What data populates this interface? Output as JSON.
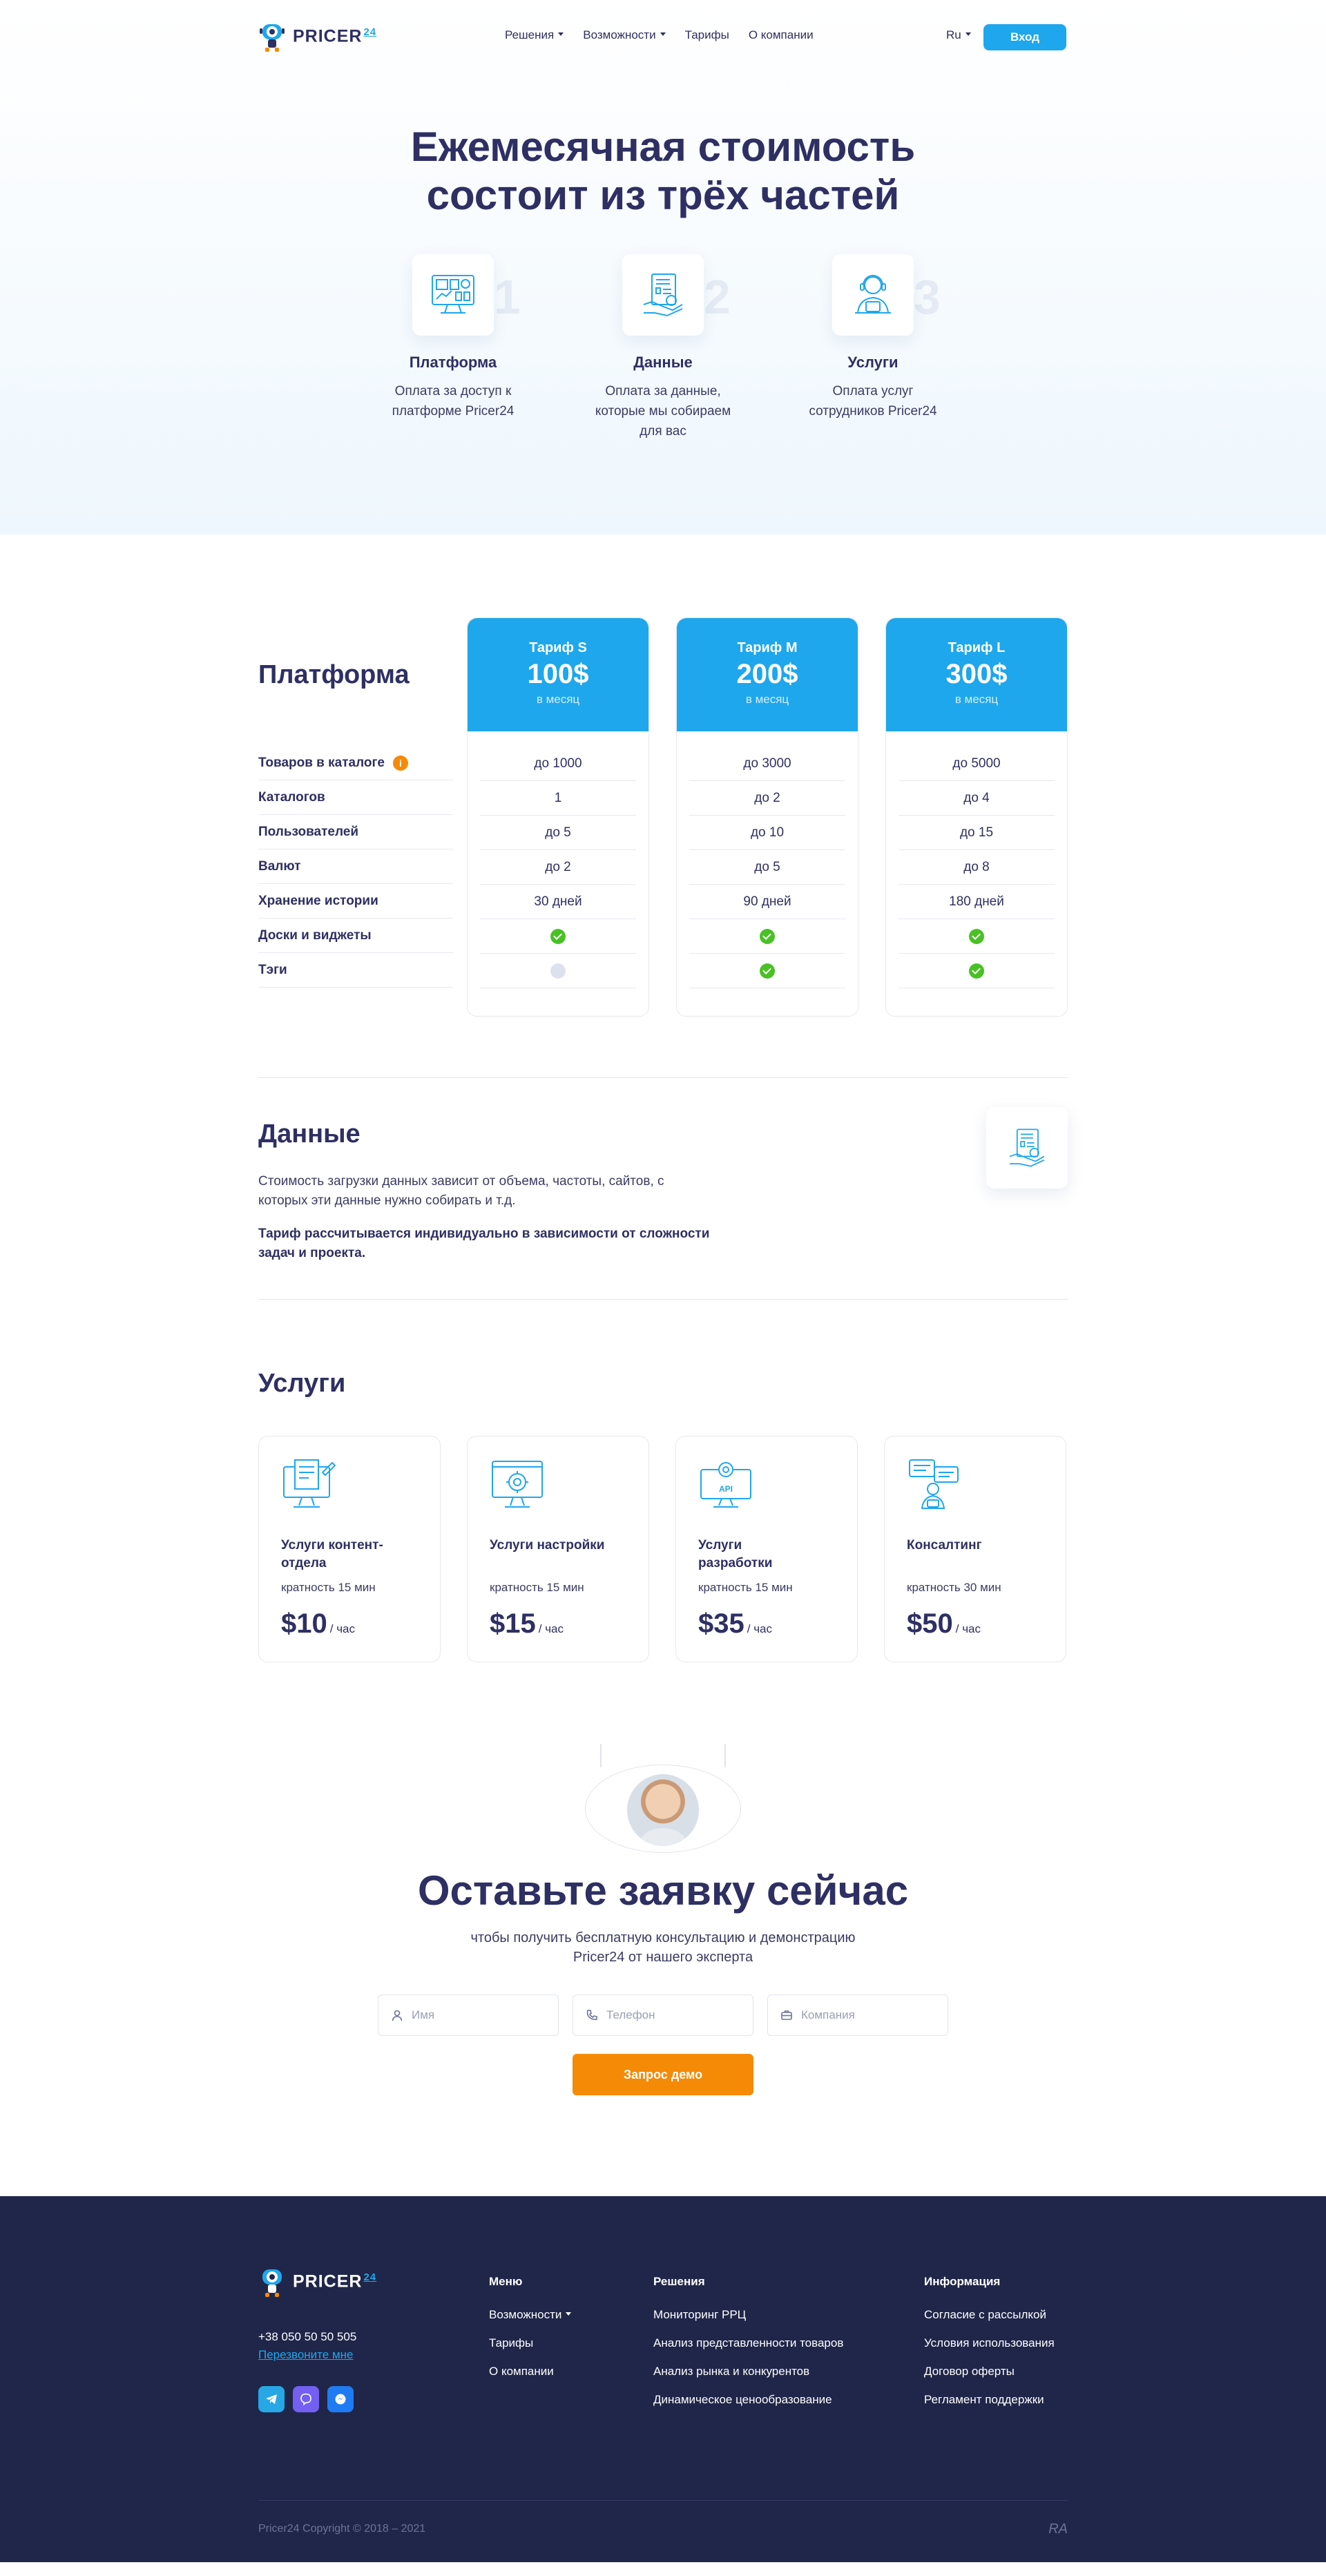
{
  "header": {
    "logo_text": "PRICER",
    "logo_num": "24",
    "nav": [
      "Решения",
      "Возможности",
      "Тарифы",
      "О компании"
    ],
    "lang": "Ru",
    "login": "Вход"
  },
  "hero": {
    "title_line1": "Ежемесячная стоимость",
    "title_line2": "состоит из трёх частей",
    "parts": [
      {
        "num": "01",
        "title": "Платформа",
        "desc": "Оплата за доступ к платформе Pricer24"
      },
      {
        "num": "02",
        "title": "Данные",
        "desc": "Оплата за данные, которые мы собираем для вас"
      },
      {
        "num": "03",
        "title": "Услуги",
        "desc": "Оплата услуг сотрудников Pricer24"
      }
    ]
  },
  "pricing": {
    "title": "Платформа",
    "features": [
      "Товаров в каталоге",
      "Каталогов",
      "Пользователей",
      "Валют",
      "Хранение истории",
      "Доски и виджеты",
      "Тэги"
    ],
    "info_mark": "i",
    "plans": [
      {
        "name": "Тариф S",
        "price": "100$",
        "per": "в месяц",
        "values": [
          "до 1000",
          "1",
          "до 5",
          "до 2",
          "30 дней"
        ],
        "widgets": true,
        "tags": false
      },
      {
        "name": "Тариф M",
        "price": "200$",
        "per": "в месяц",
        "values": [
          "до 3000",
          "до 2",
          "до 10",
          "до 5",
          "90 дней"
        ],
        "widgets": true,
        "tags": true
      },
      {
        "name": "Тариф L",
        "price": "300$",
        "per": "в месяц",
        "values": [
          "до 5000",
          "до 4",
          "до 15",
          "до 8",
          "180 дней"
        ],
        "widgets": true,
        "tags": true
      }
    ]
  },
  "data_section": {
    "title": "Данные",
    "text": "Стоимость загрузки данных зависит от объема, частоты, сайтов, с которых эти данные нужно собирать и т.д.",
    "bold": "Тариф рассчитывается индивидуально в зависимости от сложности задач и проекта."
  },
  "services": {
    "title": "Услуги",
    "items": [
      {
        "name": "Услуги контент-отдела",
        "mult": "кратность 15 мин",
        "price": "$10",
        "unit": "/ час",
        "icon": "content-icon"
      },
      {
        "name": "Услуги настройки",
        "mult": "кратность 15 мин",
        "price": "$15",
        "unit": "/ час",
        "icon": "settings-icon"
      },
      {
        "name": "Услуги разработки",
        "mult": "кратность 15 мин",
        "price": "$35",
        "unit": "/ час",
        "icon": "api-icon"
      },
      {
        "name": "Консалтинг",
        "mult": "кратность 30 мин",
        "price": "$50",
        "unit": "/ час",
        "icon": "consulting-icon"
      }
    ]
  },
  "lead": {
    "title": "Оставьте заявку сейчас",
    "sub_line1": "чтобы получить бесплатную консультацию и демонстрацию",
    "sub_line2": "Pricer24 от нашего эксперта",
    "name_placeholder": "Имя",
    "phone_placeholder": "Телефон",
    "company_placeholder": "Компания",
    "button": "Запрос демо"
  },
  "footer": {
    "phone": "+38 050 50 50 505",
    "callback": "Перезвоните мне",
    "menu_title": "Меню",
    "menu": [
      "Возможности",
      "Тарифы",
      "О компании"
    ],
    "solutions_title": "Решения",
    "solutions": [
      "Мониторинг РРЦ",
      "Анализ представленности товаров",
      "Анализ рынка и конкурентов",
      "Динамическое ценообразование"
    ],
    "info_title": "Информация",
    "info": [
      "Согласие с рассылкой",
      "Условия использования",
      "Договор оферты",
      "Регламент поддержки"
    ],
    "copyright": "Pricer24 Copyright © 2018 – 2021",
    "mark": "RA"
  },
  "colors": {
    "brand_blue": "#1ea7ec",
    "orange": "#f58a07",
    "navy": "#2e2f63",
    "footer_bg": "#1f2649",
    "check_green": "#49c125"
  }
}
